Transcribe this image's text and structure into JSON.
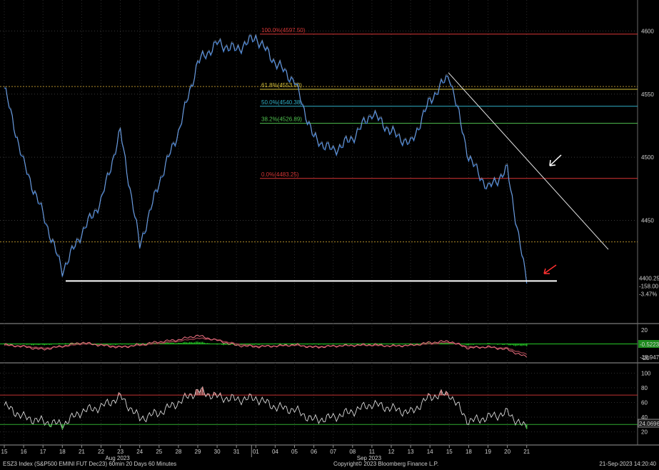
{
  "chart_data": [
    {
      "type": "line",
      "panel": "price",
      "x_labels": [
        "15",
        "16",
        "17",
        "18",
        "21",
        "22",
        "23",
        "24",
        "25",
        "28",
        "29",
        "30",
        "31",
        "01",
        "04",
        "05",
        "06",
        "07",
        "08",
        "11",
        "12",
        "13",
        "14",
        "15",
        "18",
        "19",
        "20",
        "21"
      ],
      "month_labels": [
        {
          "label": "Aug 2023",
          "after": "22"
        },
        {
          "label": "Sep 2023",
          "after": "12"
        }
      ],
      "series": [
        {
          "values": [
            4555,
            4495,
            4455,
            4410,
            4440,
            4465,
            4520,
            4430,
            4480,
            4520,
            4575,
            4590,
            4585,
            4595,
            4575,
            4560,
            4515,
            4505,
            4515,
            4535,
            4520,
            4510,
            4545,
            4565,
            4500,
            4475,
            4490,
            4400
          ]
        }
      ],
      "yticks": [
        4450,
        4500,
        4550,
        4600
      ],
      "ylim": [
        4370,
        4620
      ],
      "fib_levels": [
        {
          "label": "100.0%(4597.50)",
          "value": 4597.5,
          "color": "#d73636"
        },
        {
          "label": "61.8%(4553.80)",
          "value": 4553.8,
          "color": "#d6c23a"
        },
        {
          "label": "50.0%(4540.38)",
          "value": 4540.38,
          "color": "#2fb0c8"
        },
        {
          "label": "38.2%(4526.89)",
          "value": 4526.89,
          "color": "#4fc04f"
        },
        {
          "label": "0.0%(4483.25)",
          "value": 4483.25,
          "color": "#d73636"
        }
      ],
      "reference_levels": [
        4556,
        4433
      ],
      "support_level": 4402,
      "last": {
        "price": "4400.25",
        "change": "-158.00",
        "pct": "-3.47%"
      }
    },
    {
      "type": "line",
      "panel": "momentum",
      "series": [
        {
          "values": [
            -1,
            -4,
            -8,
            -3,
            2,
            -2,
            -5,
            -1,
            3,
            6,
            12,
            5,
            -2,
            -4,
            -3,
            -1,
            -5,
            -3,
            -2,
            -1,
            -3,
            -2,
            2,
            4,
            -6,
            -4,
            -8,
            -19
          ]
        },
        {
          "values": [
            -2,
            -3,
            -6,
            -4,
            0,
            -1,
            -4,
            -2,
            1,
            4,
            8,
            6,
            0,
            -3,
            -3,
            -2,
            -4,
            -3,
            -2,
            -2,
            -3,
            -2,
            0,
            2,
            -4,
            -5,
            -6,
            -15
          ]
        }
      ],
      "ylim": [
        -25,
        25
      ],
      "yticks": [
        20,
        -20
      ],
      "last_values": [
        "-0.5223",
        "-18.9473"
      ]
    },
    {
      "type": "line",
      "panel": "rsi",
      "series": [
        {
          "values": [
            56,
            40,
            34,
            30,
            48,
            54,
            68,
            38,
            46,
            60,
            76,
            68,
            64,
            66,
            54,
            50,
            36,
            40,
            48,
            58,
            52,
            46,
            68,
            72,
            34,
            40,
            46,
            24
          ]
        }
      ],
      "ylim": [
        5,
        112
      ],
      "yticks": [
        100,
        80,
        60,
        40,
        20
      ],
      "bands": [
        70,
        30
      ],
      "last_value": "24.0696"
    }
  ],
  "footer": {
    "left": "ESZ3 Index (S&P500 EMINI FUT  Dec23) 60min 20 Days 60 Minutes",
    "center": "Copyright© 2023 Bloomberg Finance L.P.",
    "right": "21-Sep-2023 14:20:40"
  },
  "colors": {
    "price_line": "#4a86d8",
    "momentum_fast": "#e06a7a",
    "momentum_slow": "#8a3a44",
    "hist": "#26c826",
    "rsi": "#d9d9d9",
    "annotation_white": "#ffffff",
    "annotation_red": "#ff3030"
  }
}
